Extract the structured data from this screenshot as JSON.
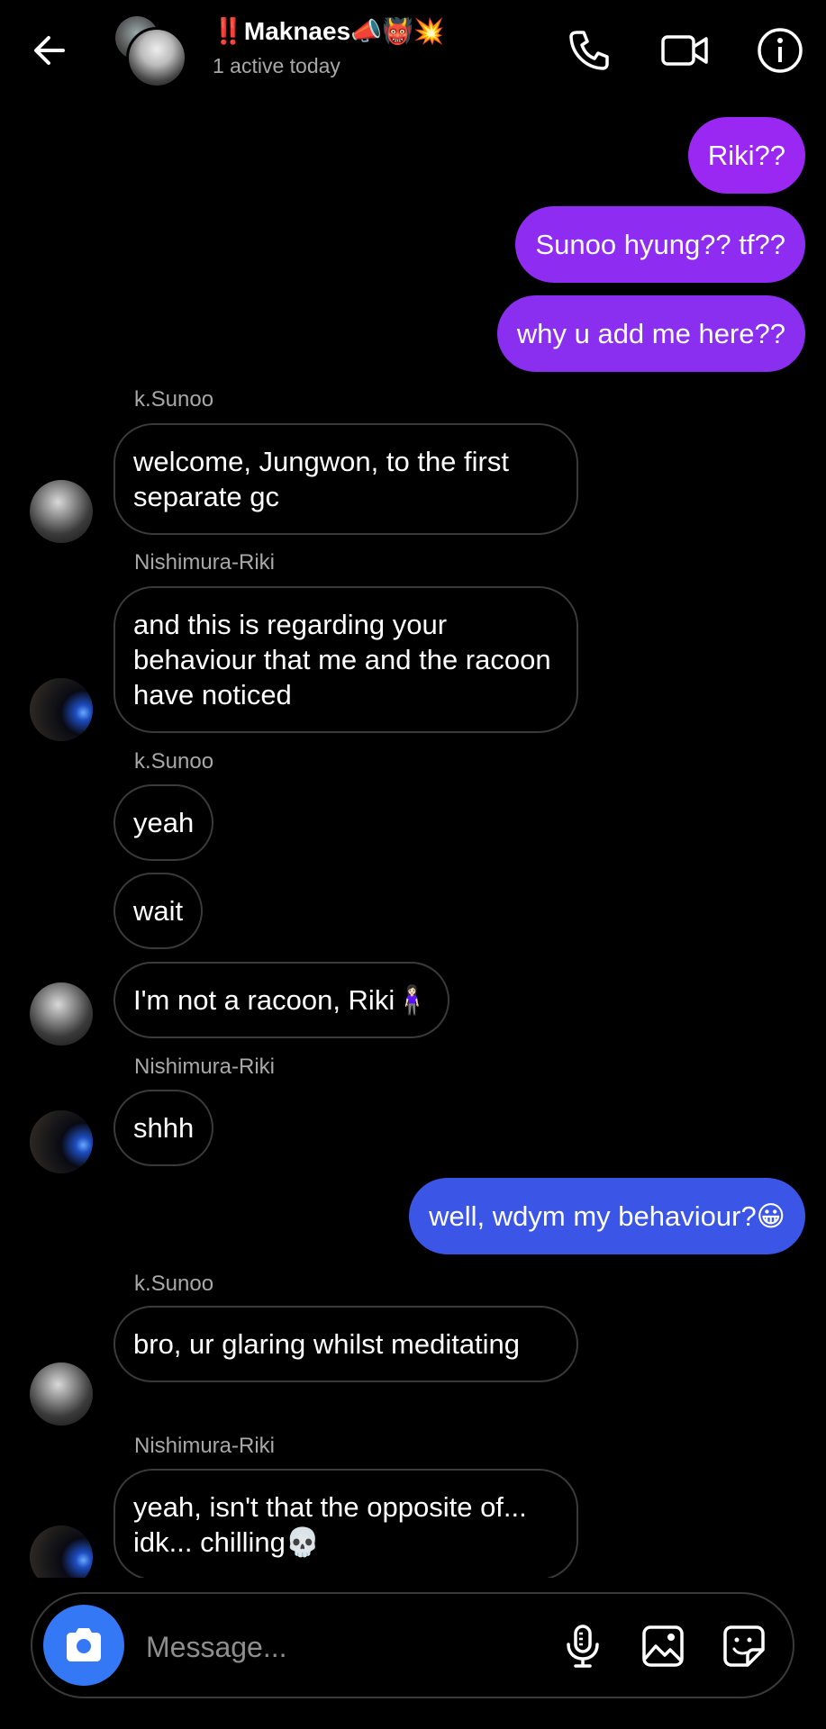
{
  "header": {
    "title": "‼️Maknaes📣👹💥",
    "subtitle": "1 active today",
    "icons": [
      "back-arrow-icon",
      "phone-icon",
      "video-camera-icon",
      "info-icon"
    ]
  },
  "messages": [
    {
      "type": "outgoing",
      "text": "Riki??",
      "color": "#9b27f2"
    },
    {
      "type": "outgoing",
      "text": "Sunoo hyung?? tf??",
      "color": "#8f2cf2"
    },
    {
      "type": "outgoing",
      "text": "why u add me here??",
      "color": "#8a2ef0"
    },
    {
      "type": "sender",
      "text": "k.Sunoo"
    },
    {
      "type": "incoming",
      "text": "welcome, Jungwon, to the first separate gc"
    },
    {
      "type": "sender",
      "text": "Nishimura-Riki"
    },
    {
      "type": "incoming",
      "text": "and this is regarding your behaviour that me and the racoon have noticed"
    },
    {
      "type": "sender",
      "text": "k.Sunoo"
    },
    {
      "type": "incoming",
      "text": "yeah"
    },
    {
      "type": "incoming",
      "text": "wait"
    },
    {
      "type": "incoming",
      "text": "I'm not a racoon, Riki🧍🏻‍♀️"
    },
    {
      "type": "sender",
      "text": "Nishimura-Riki"
    },
    {
      "type": "incoming",
      "text": "shhh"
    },
    {
      "type": "outgoing",
      "text": "well, wdym my behaviour?😀",
      "color": "#3b55e6"
    },
    {
      "type": "sender",
      "text": "k.Sunoo"
    },
    {
      "type": "incoming",
      "text": "bro, ur glaring whilst meditating"
    },
    {
      "type": "sender",
      "text": "Nishimura-Riki"
    },
    {
      "type": "incoming",
      "text": "yeah, isn't that the opposite of... idk... chilling💀"
    }
  ],
  "composer": {
    "placeholder": "Message...",
    "camera_color": "#3478f6",
    "icons": [
      "camera-icon",
      "microphone-icon",
      "gallery-icon",
      "sticker-icon"
    ]
  }
}
